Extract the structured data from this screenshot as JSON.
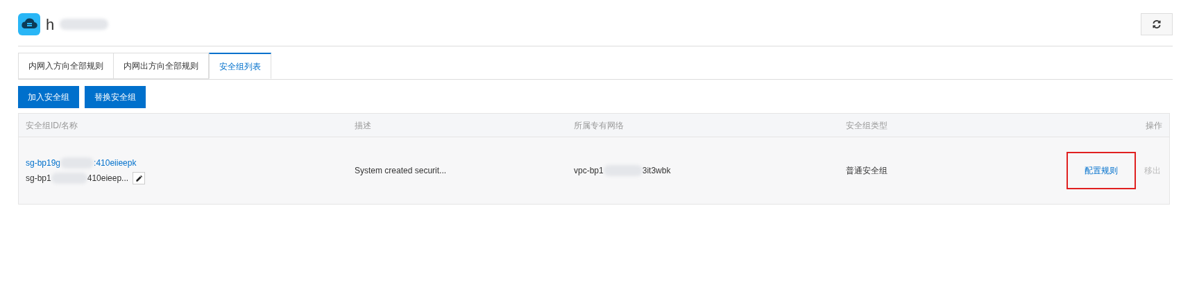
{
  "header": {
    "title": "h"
  },
  "tabs": [
    {
      "label": "内网入方向全部规则",
      "selected": false
    },
    {
      "label": "内网出方向全部规则",
      "selected": false
    },
    {
      "label": "安全组列表",
      "selected": true
    }
  ],
  "buttons": [
    "加入安全组",
    "替换安全组"
  ],
  "table": {
    "columns": [
      "安全组ID/名称",
      "描述",
      "所属专有网络",
      "安全组类型",
      "操作"
    ],
    "rows": [
      {
        "id_start": "sg-bp19g",
        "id_end": ":410eiieepk",
        "name_start": "sg-bp1",
        "name_end": "410eieep...",
        "description": "System created securit...",
        "vpc_start": "vpc-bp1",
        "vpc_end": "3it3wbk",
        "type": "普通安全组",
        "actions": [
          {
            "label": "配置规则",
            "disabled": false,
            "highlighted": true
          },
          {
            "label": "移出",
            "disabled": true,
            "highlighted": false
          }
        ]
      }
    ]
  }
}
